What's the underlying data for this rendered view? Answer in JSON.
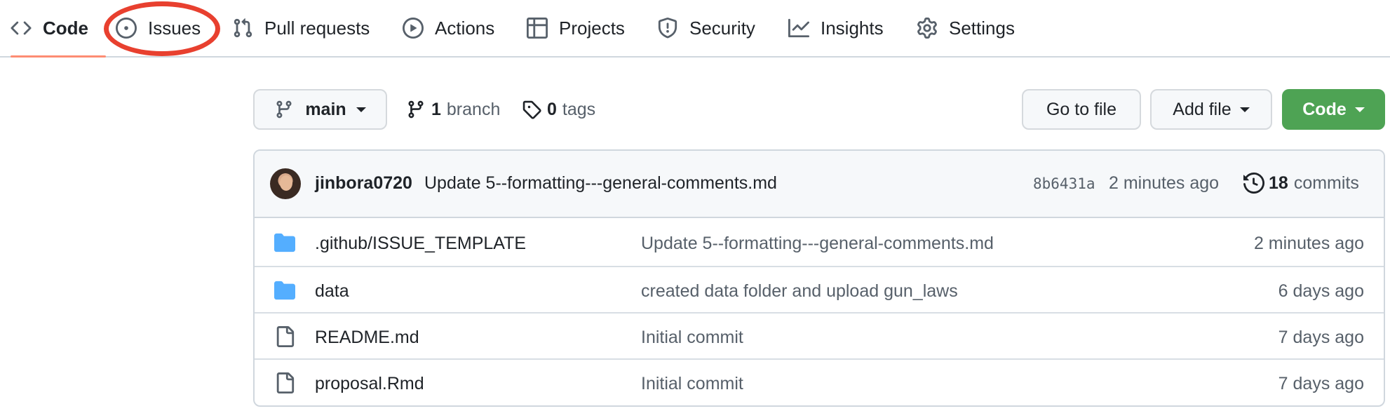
{
  "nav": {
    "tabs": [
      {
        "label": "Code",
        "icon": "code-icon",
        "active": true
      },
      {
        "label": "Issues",
        "icon": "issue-opened-icon",
        "active": false
      },
      {
        "label": "Pull requests",
        "icon": "git-pull-request-icon",
        "active": false
      },
      {
        "label": "Actions",
        "icon": "play-icon",
        "active": false
      },
      {
        "label": "Projects",
        "icon": "table-icon",
        "active": false
      },
      {
        "label": "Security",
        "icon": "shield-icon",
        "active": false
      },
      {
        "label": "Insights",
        "icon": "graph-icon",
        "active": false
      },
      {
        "label": "Settings",
        "icon": "gear-icon",
        "active": false
      }
    ],
    "active_underline_color": "#fd8c73",
    "highlighted_tab": "Issues",
    "highlight_color": "#e8402f"
  },
  "toolbar": {
    "branch_name": "main",
    "branches_count": "1",
    "branches_label": "branch",
    "tags_count": "0",
    "tags_label": "tags",
    "goto_file_label": "Go to file",
    "add_file_label": "Add file",
    "code_label": "Code",
    "code_button_color": "#4ea354"
  },
  "latest_commit": {
    "author": "jinbora0720",
    "message": "Update 5--formatting---general-comments.md",
    "sha": "8b6431a",
    "time": "2 minutes ago",
    "commits_count": "18",
    "commits_label": "commits"
  },
  "files": [
    {
      "type": "folder",
      "icon": "folder-icon",
      "name": ".github/ISSUE_TEMPLATE",
      "commit_message": "Update 5--formatting---general-comments.md",
      "age": "2 minutes ago"
    },
    {
      "type": "folder",
      "icon": "folder-icon",
      "name": "data",
      "commit_message": "created data folder and upload gun_laws",
      "age": "6 days ago"
    },
    {
      "type": "file",
      "icon": "file-icon",
      "name": "README.md",
      "commit_message": "Initial commit",
      "age": "7 days ago"
    },
    {
      "type": "file",
      "icon": "file-icon",
      "name": "proposal.Rmd",
      "commit_message": "Initial commit",
      "age": "7 days ago"
    }
  ],
  "colors": {
    "folder": "#54aeff",
    "muted_text": "#57606a",
    "border": "#d0d7de"
  }
}
